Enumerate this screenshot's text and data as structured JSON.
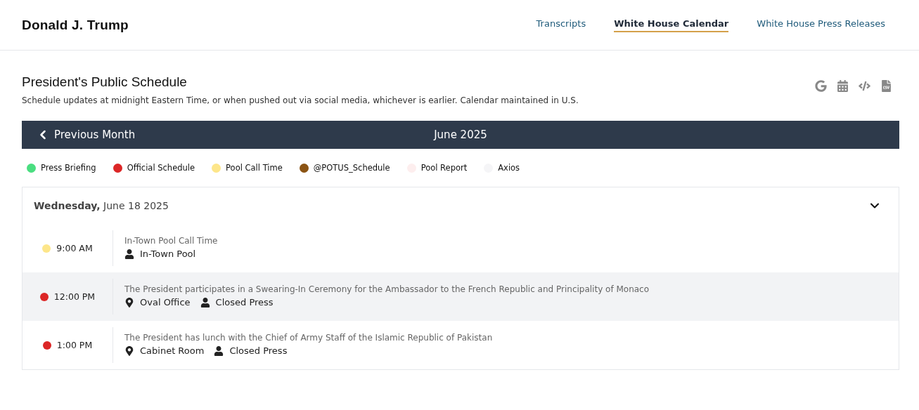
{
  "site_title": "Donald J. Trump",
  "nav": [
    {
      "label": "Transcripts",
      "selected": false
    },
    {
      "label": "White House Calendar",
      "selected": true
    },
    {
      "label": "White House Press Releases",
      "selected": false
    }
  ],
  "heading": "President's Public Schedule",
  "subtitle": "Schedule updates at midnight Eastern Time, or when pushed out via social media, whichever is earlier. Calendar maintained in U.S.",
  "toolbar": [
    {
      "kind": "google"
    },
    {
      "kind": "calendar"
    },
    {
      "kind": "embed"
    },
    {
      "kind": "csv"
    }
  ],
  "month_bar": {
    "previous": "Previous Month",
    "month": "June 2025"
  },
  "legend": [
    {
      "label": "Press Briefing",
      "color": "#4ade80"
    },
    {
      "label": "Official Schedule",
      "color": "#dc2626"
    },
    {
      "label": "Pool Call Time",
      "color": "#fde68a"
    },
    {
      "label": "@POTUS_Schedule",
      "color": "#8b5414"
    },
    {
      "label": "Pool Report",
      "color": "#fdeeee"
    },
    {
      "label": "Axios",
      "color": "#f5f5f7"
    }
  ],
  "day": {
    "title": "**Wednesday,** June 18 2025",
    "expanded": true,
    "events": [
      {
        "time": "9:00 AM",
        "color": "#fde68a",
        "highlighted": false,
        "title": "In-Town Pool Call Time",
        "details": [
          {
            "kind": "coverage",
            "label": "In-Town Pool"
          }
        ]
      },
      {
        "time": "12:00 PM",
        "color": "#dc2626",
        "highlighted": true,
        "title": "The President participates in a Swearing-In Ceremony for the Ambassador to the French Republic and Principality of Monaco",
        "details": [
          {
            "kind": "location",
            "label": "Oval Office"
          },
          {
            "kind": "coverage",
            "label": "Closed Press"
          }
        ]
      },
      {
        "time": "1:00 PM",
        "color": "#dc2626",
        "highlighted": false,
        "title": "The President has lunch with the Chief of Army Staff of the Islamic Republic of Pakistan",
        "details": [
          {
            "kind": "location",
            "label": "Cabinet Room"
          },
          {
            "kind": "coverage",
            "label": "Closed Press"
          }
        ]
      }
    ]
  }
}
